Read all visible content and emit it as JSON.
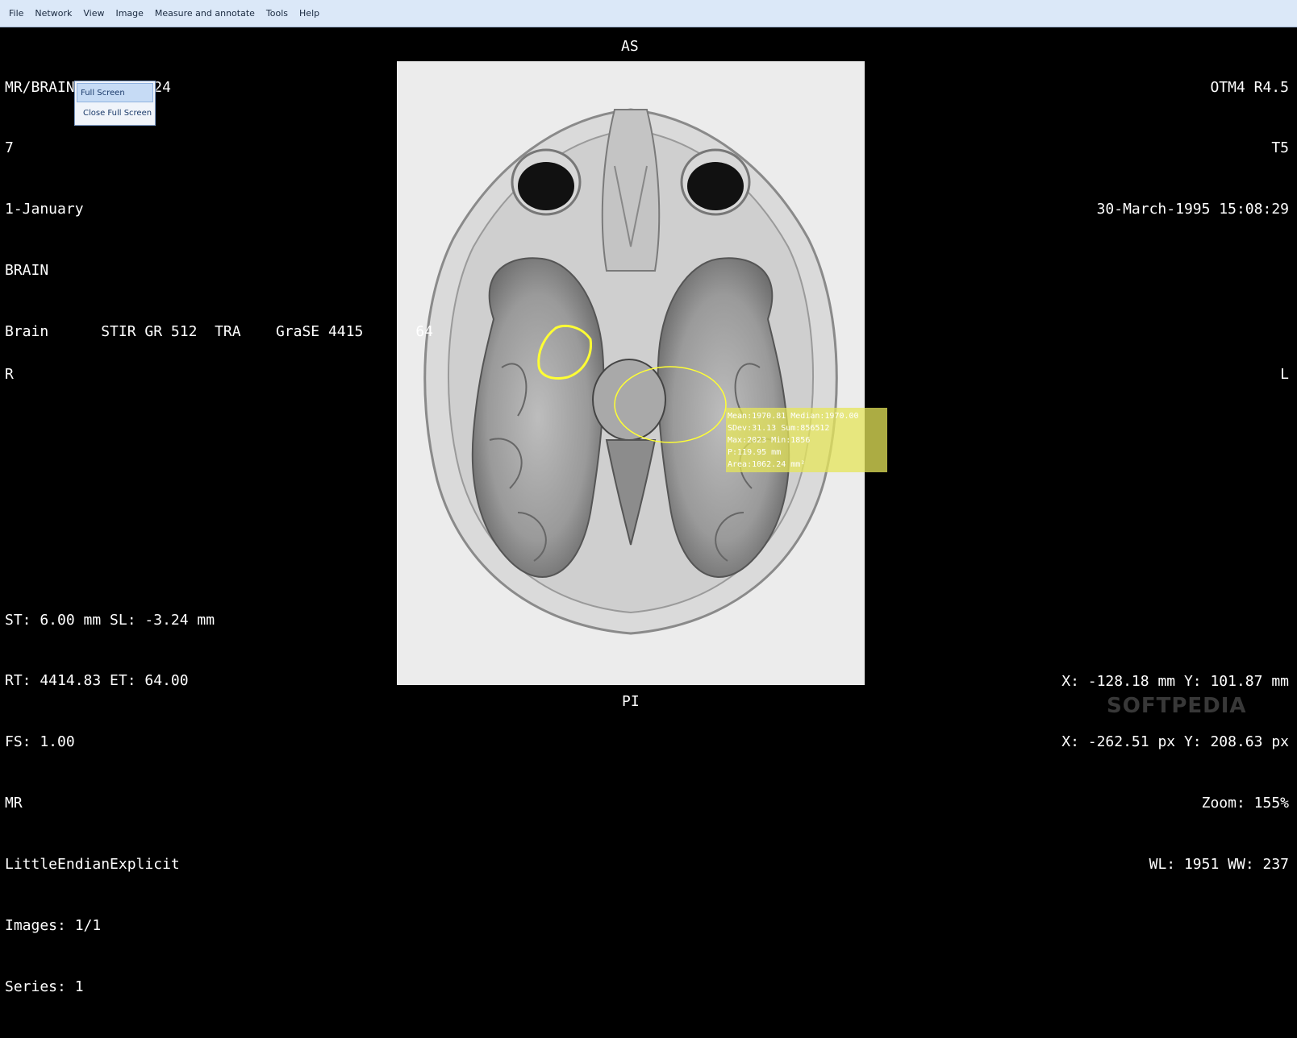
{
  "menu": [
    "File",
    "Network",
    "View",
    "Image",
    "Measure and annotate",
    "Tools",
    "Help"
  ],
  "context_menu": {
    "items": [
      "Full Screen",
      "Close Full Screen"
    ]
  },
  "overlay": {
    "top_left": [
      "MR/BRAIN/GRASE/1024",
      "7",
      "1-January",
      "BRAIN",
      "Brain      STIR GR 512  TRA    GraSE 4415      64"
    ],
    "top_right": [
      "OTM4 R4.5",
      "T5",
      "30-March-1995 15:08:29"
    ],
    "top_center": "AS",
    "bottom_center": "PI",
    "left_center": "R",
    "right_center": "L",
    "bottom_left": [
      "ST: 6.00 mm SL: -3.24 mm",
      "RT: 4414.83 ET: 64.00",
      "FS: 1.00",
      "MR",
      "LittleEndianExplicit",
      "Images: 1/1",
      "Series: 1"
    ],
    "bottom_right": [
      "X: -128.18 mm Y: 101.87 mm",
      "X: -262.51 px Y: 208.63 px",
      "Zoom: 155%",
      "WL: 1951 WW: 237"
    ]
  },
  "roi_stats": [
    "Mean:1970.81 Median:1970.00",
    "SDev:31.13 Sum:856512",
    "Max:2023 Min:1856",
    "P:119.95 mm",
    "Area:1062.24 mm²"
  ],
  "watermark": "SOFTPEDIA",
  "colors": {
    "menubar": "#dbe8f8",
    "annotation": "#ffff33",
    "stats_bg": "#e6e65a"
  }
}
